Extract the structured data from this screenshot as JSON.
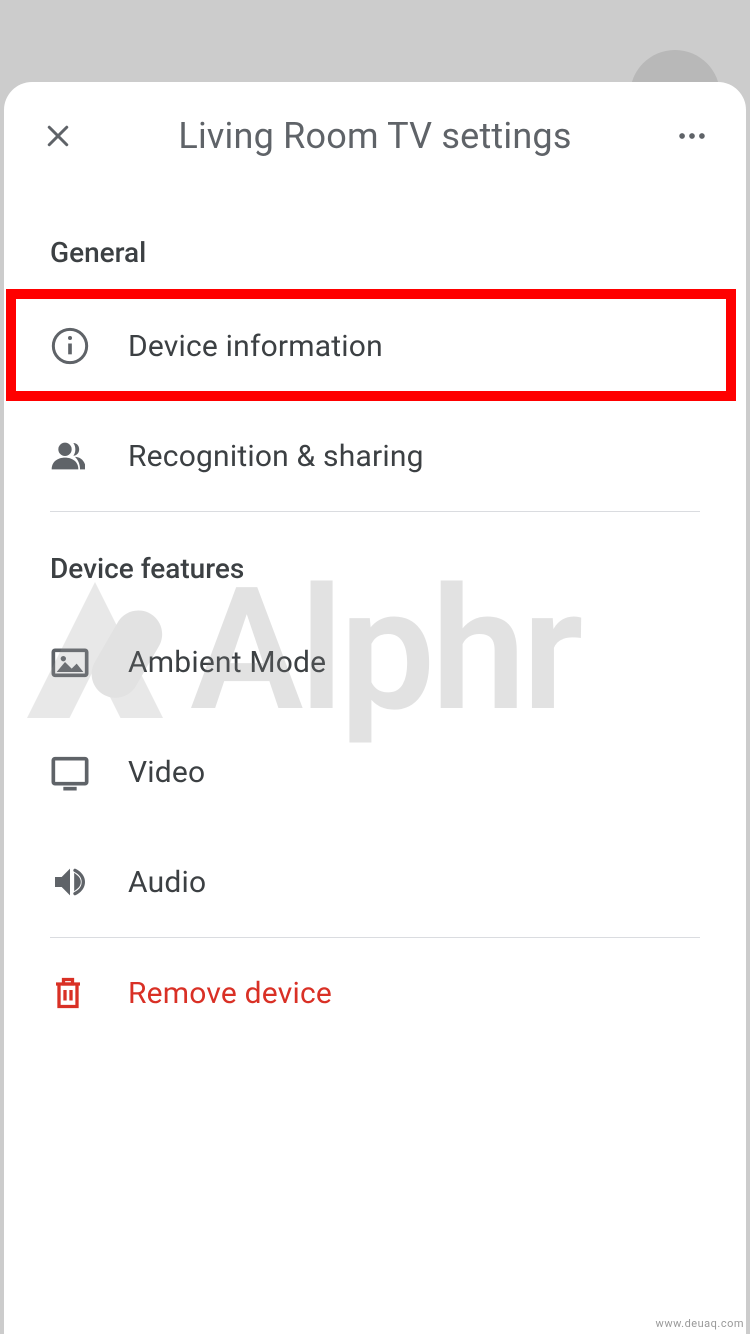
{
  "header": {
    "title": "Living Room TV settings"
  },
  "sections": {
    "general": {
      "header": "General",
      "items": {
        "device_info": "Device information",
        "recognition": "Recognition & sharing"
      }
    },
    "device_features": {
      "header": "Device features",
      "items": {
        "ambient": "Ambient Mode",
        "video": "Video",
        "audio": "Audio"
      }
    }
  },
  "actions": {
    "remove": "Remove device"
  },
  "watermark": {
    "text": "Alphr",
    "source": "www.deuaq.com"
  },
  "highlight": {
    "target": "device_info"
  }
}
